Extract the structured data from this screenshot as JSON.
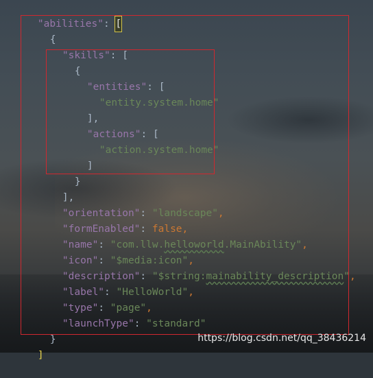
{
  "code": {
    "line1": {
      "key": "\"abilities\"",
      "colon": ": ",
      "bracket": "["
    },
    "line2": "{",
    "line3": {
      "key": "\"skills\"",
      "colon": ": ",
      "bracket": "["
    },
    "line4": "{",
    "line5": {
      "key": "\"entities\"",
      "colon": ": ",
      "bracket": "["
    },
    "line6": "\"entity.system.home\"",
    "line7": "],",
    "line8": {
      "key": "\"actions\"",
      "colon": ": ",
      "bracket": "["
    },
    "line9": "\"action.system.home\"",
    "line10": "]",
    "line11": "}",
    "line12": "],",
    "orientation": {
      "key": "\"orientation\"",
      "value": "\"landscape\""
    },
    "formEnabled": {
      "key": "\"formEnabled\"",
      "value": "false"
    },
    "name": {
      "key": "\"name\"",
      "value_pre": "\"com.llw.",
      "value_mid": "helloworld",
      "value_post": ".MainAbility\""
    },
    "icon": {
      "key": "\"icon\"",
      "value": "\"$media:icon\""
    },
    "description": {
      "key": "\"description\"",
      "value_pre": "\"$string:",
      "value_mid": "mainability_description",
      "value_post": "\""
    },
    "label": {
      "key": "\"label\"",
      "value": "\"HelloWorld\""
    },
    "type": {
      "key": "\"type\"",
      "value": "\"page\""
    },
    "launchType": {
      "key": "\"launchType\"",
      "value": "\"standard\""
    },
    "close_obj": "}",
    "close_arr": "]"
  },
  "punct": {
    "comma": ",",
    "colon": ": "
  },
  "watermark": "https://blog.csdn.net/qq_38436214",
  "colors": {
    "key": "#9876aa",
    "string": "#6a8759",
    "keyword": "#cc7832",
    "highlight_box": "#d1282f"
  }
}
